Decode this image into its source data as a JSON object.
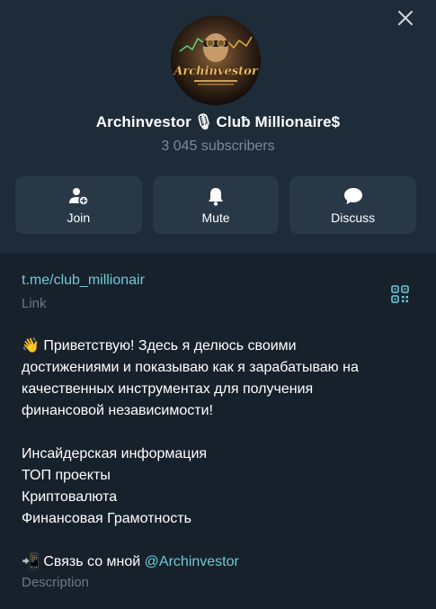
{
  "header": {
    "title_prefix": "Archinvestor",
    "title_icon": "microphone-emoji",
    "title_suffix": "Cluƀ Millionaire$",
    "subscribers": "3 045 subscribers",
    "avatar_text": "Archinvestor"
  },
  "actions": [
    {
      "label": "Join",
      "icon": "add-user-icon"
    },
    {
      "label": "Mute",
      "icon": "bell-icon"
    },
    {
      "label": "Discuss",
      "icon": "chat-bubble-icon"
    }
  ],
  "info": {
    "link": "t.me/club_millionair",
    "link_caption": "Link",
    "description_lines": [
      "👋 Приветствую! Здесь я делюсь своими",
      "достижениями и показываю как я зарабатываю на",
      "качественных инструментах для получения",
      "финансовой независимости!",
      "",
      "Инсайдерская информация",
      "ТОП проекты",
      "Криптовалюта",
      "Финансовая Грамотность",
      ""
    ],
    "contact_prefix": "📲 Связь со мной ",
    "contact_mention": "@Archinvestor",
    "description_caption": "Description"
  },
  "colors": {
    "header_bg": "#1e2c3a",
    "info_bg": "#17212b",
    "button_bg": "#283847",
    "accent": "#70c8d8",
    "muted": "#6d7883"
  }
}
